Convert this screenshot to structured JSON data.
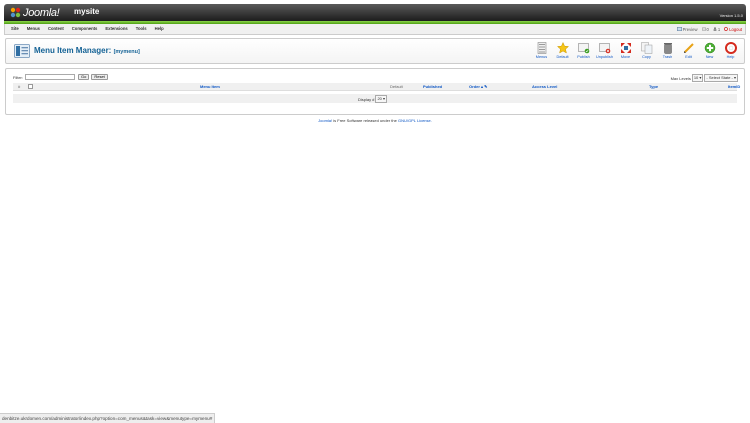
{
  "header": {
    "logo_text": "Joomla!",
    "site_name": "mysite",
    "version": "Version 1.5.0"
  },
  "menu": [
    "Site",
    "Menus",
    "Content",
    "Components",
    "Extensions",
    "Tools",
    "Help"
  ],
  "status": {
    "preview": "Preview",
    "messages": "0",
    "users": "1",
    "logout": "Logout"
  },
  "page": {
    "title": "Menu Item Manager:",
    "subtitle": "[mymenu]"
  },
  "toolbar": [
    {
      "label": "Menus",
      "icon": "menus-icon"
    },
    {
      "label": "Default",
      "icon": "star-icon"
    },
    {
      "label": "Publish",
      "icon": "publish-icon"
    },
    {
      "label": "Unpublish",
      "icon": "unpublish-icon"
    },
    {
      "label": "Move",
      "icon": "move-icon"
    },
    {
      "label": "Copy",
      "icon": "copy-icon"
    },
    {
      "label": "Trash",
      "icon": "trash-icon"
    },
    {
      "label": "Edit",
      "icon": "edit-icon"
    },
    {
      "label": "New",
      "icon": "new-icon"
    },
    {
      "label": "Help",
      "icon": "help-icon"
    }
  ],
  "filter": {
    "label": "Filter:",
    "value": "",
    "go": "Go",
    "reset": "Reset",
    "max_levels_label": "Max Levels",
    "max_levels_value": "10",
    "state_value": "- Select State -"
  },
  "table": {
    "headers": {
      "num": "#",
      "menu_item": "Menu Item",
      "default": "Default",
      "published": "Published",
      "order": "Order",
      "access": "Access Level",
      "type": "Type",
      "itemid": "ItemID"
    },
    "display_label": "Display #",
    "display_value": "20"
  },
  "footer": {
    "joomla_link": "Joomla!",
    "text": "is Free Software released under the",
    "license_link": "GNU/GPL License."
  },
  "statusbar": "denbitze.ukrdomen.com/administrator/index.php?option=com_menus&task=view&menutype=mymenu#",
  "colors": {
    "title_blue": "#146295",
    "link_blue": "#0b55c4",
    "header_green": "#6bbf25"
  }
}
